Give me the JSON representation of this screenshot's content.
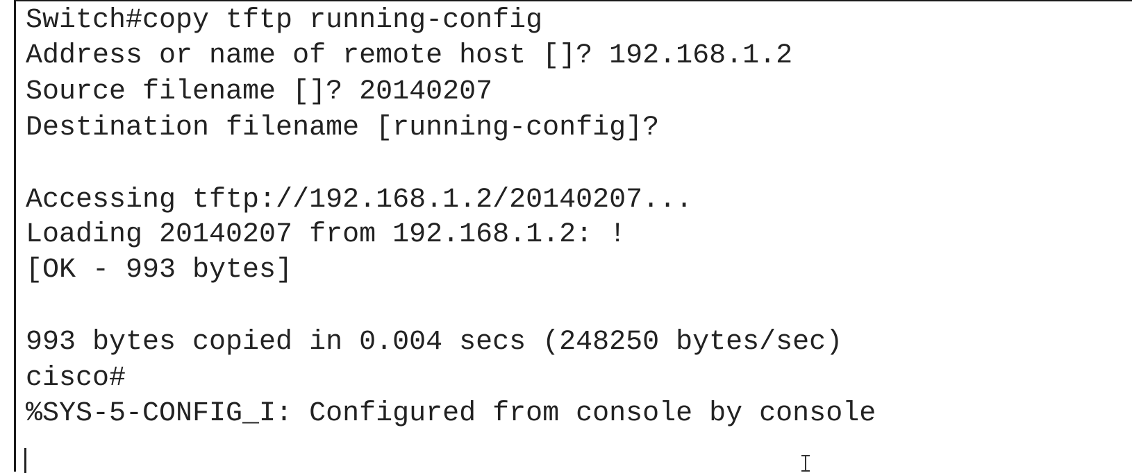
{
  "terminal": {
    "lines": [
      "Switch#copy tftp running-config",
      "Address or name of remote host []? 192.168.1.2",
      "Source filename []? 20140207",
      "Destination filename [running-config]?",
      "Accessing tftp://192.168.1.2/20140207...",
      "Loading 20140207 from 192.168.1.2: !",
      "[OK - 993 bytes]",
      "993 bytes copied in 0.004 secs (248250 bytes/sec)",
      "cisco#",
      "%SYS-5-CONFIG_I: Configured from console by console"
    ]
  },
  "pointer": {
    "icon": "text-cursor-ibeam-icon"
  },
  "colors": {
    "background": "#ffffff",
    "text": "#222222",
    "border": "#1a1a1a"
  }
}
